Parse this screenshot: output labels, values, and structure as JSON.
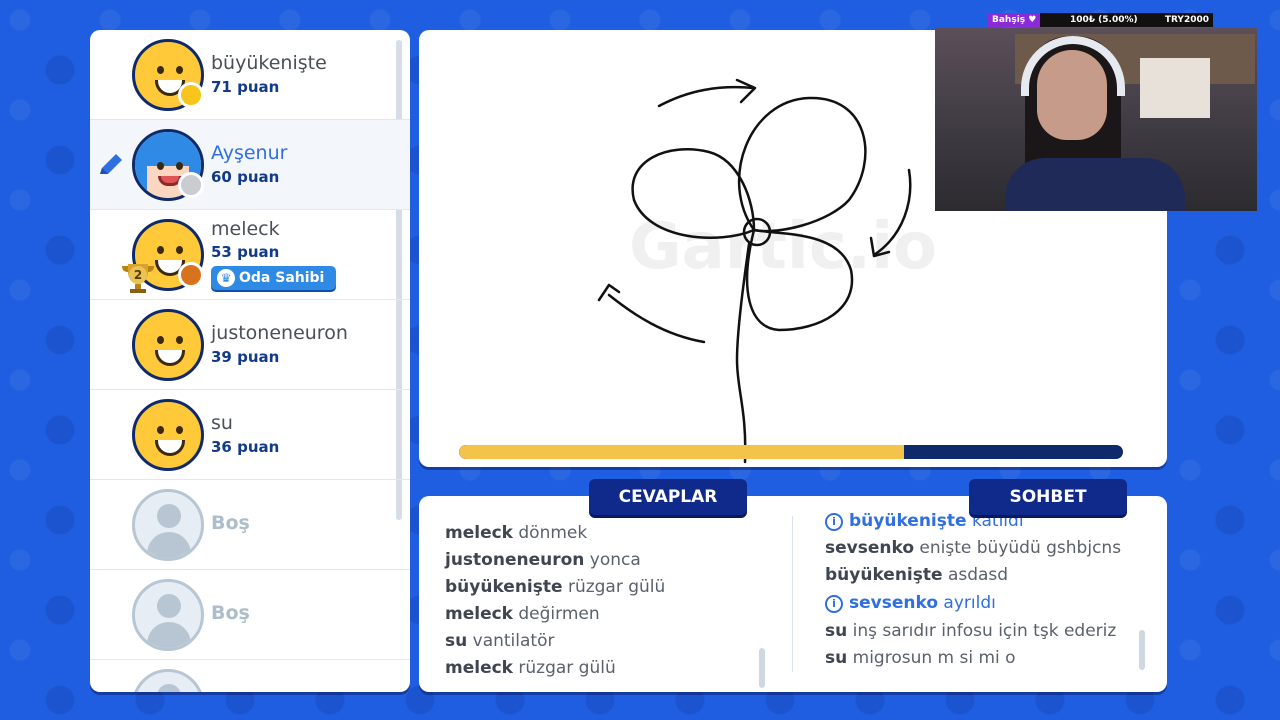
{
  "webcam_overlay": {
    "tag": "Bahşiş ♥",
    "donation": "100₺ (5.00%)",
    "goal": "TRY2000"
  },
  "players": [
    {
      "name": "büyükenişte",
      "score": "71 puan",
      "status_color": "#f7c51b",
      "avatar": "yellow-smile-avatar",
      "drawing": false
    },
    {
      "name": "Ayşenur",
      "score": "60 puan",
      "status_color": "#c9ccd1",
      "avatar": "blue-hair-girl-avatar",
      "drawing": true
    },
    {
      "name": "meleck",
      "score": "53 puan",
      "status_color": "#d8721c",
      "avatar": "yellow-smile-avatar",
      "owner_badge": "Oda Sahibi",
      "rank": "2"
    },
    {
      "name": "justoneneuron",
      "score": "39 puan",
      "avatar": "yellow-smile-avatar"
    },
    {
      "name": "su",
      "score": "36 puan",
      "avatar": "yellow-smile-avatar"
    },
    {
      "name": "Boş",
      "avatar": "empty-slot-avatar"
    },
    {
      "name": "Boş",
      "avatar": "empty-slot-avatar"
    }
  ],
  "canvas": {
    "watermark": "Gartic.io",
    "progress": 0.67
  },
  "tabs": {
    "answers": "CEVAPLAR",
    "chat": "SOHBET"
  },
  "answers": [
    {
      "user": "meleck",
      "text": "dönmek"
    },
    {
      "user": "justoneneuron",
      "text": "yonca"
    },
    {
      "user": "büyükenişte",
      "text": "rüzgar gülü"
    },
    {
      "user": "meleck",
      "text": "değirmen"
    },
    {
      "user": "su",
      "text": "vantilatör"
    },
    {
      "user": "meleck",
      "text": "rüzgar gülü"
    }
  ],
  "chat": [
    {
      "type": "system",
      "user": "büyükenişte",
      "text": "katıldı"
    },
    {
      "type": "msg",
      "user": "sevsenko",
      "text": "enişte büyüdü gshbjcns"
    },
    {
      "type": "msg",
      "user": "büyükenişte",
      "text": "asdasd"
    },
    {
      "type": "system",
      "user": "sevsenko",
      "text": "ayrıldı"
    },
    {
      "type": "msg",
      "user": "su",
      "text": "inş sarıdır infosu için tşk ederiz"
    },
    {
      "type": "msg",
      "user": "su",
      "text": "migrosun m si mi o"
    }
  ],
  "colors": {
    "background": "#1f5ee0",
    "accent": "#2f6fe0",
    "navy": "#0f2a8a",
    "progress_fill": "#f4c34a"
  }
}
